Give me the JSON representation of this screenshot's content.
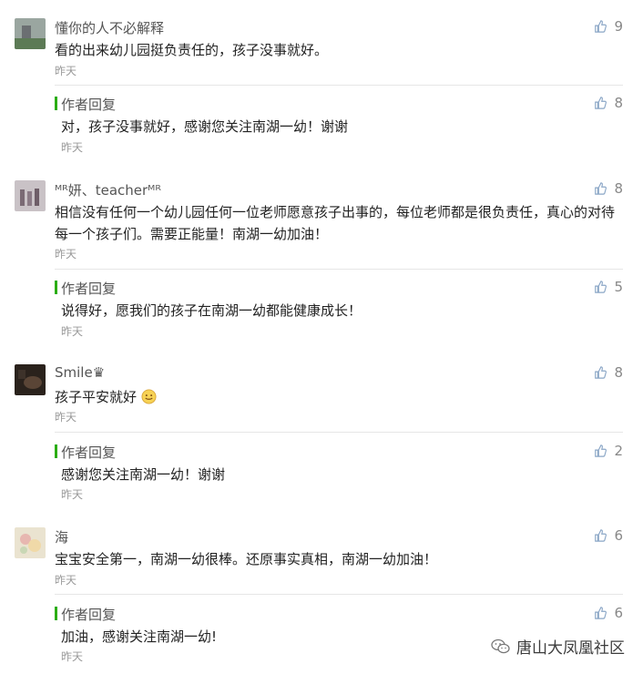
{
  "colors": {
    "reply_accent": "#2bad13",
    "like_icon": "#8aa6c6"
  },
  "comments": [
    {
      "nickname": "懂你的人不必解释",
      "text": "看的出来幼儿园挺负责任的，孩子没事就好。",
      "time": "昨天",
      "likes": "9",
      "reply": {
        "title": "作者回复",
        "text": "对，孩子没事就好，感谢您关注南湖一幼！谢谢",
        "time": "昨天",
        "likes": "8"
      }
    },
    {
      "nickname": "ᴹᴿ妍、teacherᴹᴿ",
      "text": "相信没有任何一个幼儿园任何一位老师愿意孩子出事的，每位老师都是很负责任，真心的对待每一个孩子们。需要正能量！南湖一幼加油！",
      "time": "昨天",
      "likes": "8",
      "reply": {
        "title": "作者回复",
        "text": "说得好，愿我们的孩子在南湖一幼都能健康成长！",
        "time": "昨天",
        "likes": "5"
      }
    },
    {
      "nickname": "Smile♛",
      "text": "孩子平安就好",
      "time": "昨天",
      "likes": "8",
      "reply": {
        "title": "作者回复",
        "text": "感谢您关注南湖一幼！谢谢",
        "time": "昨天",
        "likes": "2"
      }
    },
    {
      "nickname": "海",
      "text": "宝宝安全第一，南湖一幼很棒。还原事实真相，南湖一幼加油！",
      "time": "昨天",
      "likes": "6",
      "reply": {
        "title": "作者回复",
        "text": "加油，感谢关注南湖一幼!",
        "time": "昨天",
        "likes": "6"
      }
    }
  ],
  "watermark": {
    "text": "唐山大凤凰社区",
    "icon": "wechat-icon"
  }
}
